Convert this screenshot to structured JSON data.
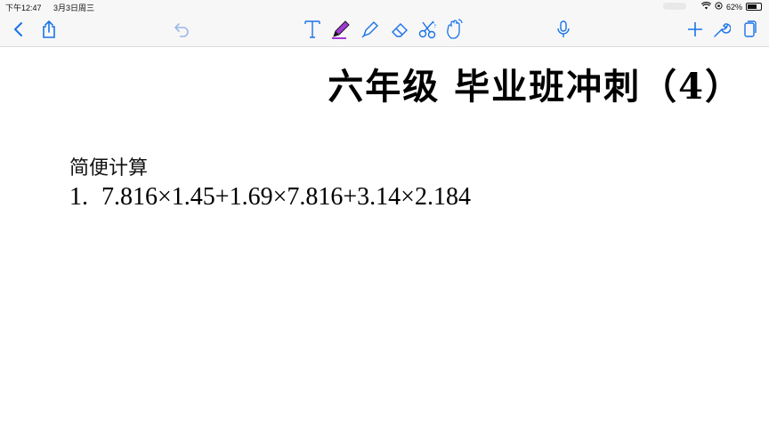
{
  "status_bar": {
    "time": "下午12:47",
    "date": "3月3日周三",
    "battery": "62%"
  },
  "toolbar": {
    "icons": [
      "back-icon",
      "share-icon",
      "undo-icon",
      "text-tool-icon",
      "pen-tool-icon",
      "highlighter-icon",
      "eraser-icon",
      "lasso-scissors-icon",
      "gesture-hand-icon",
      "microphone-icon",
      "add-icon",
      "settings-wrench-icon",
      "pages-icon"
    ],
    "accent_color": "#1a73e8",
    "pen_color": "#a338d6"
  },
  "document": {
    "title": "六年级   毕业班冲刺（4）",
    "section_label": "简便计算",
    "problems": [
      {
        "number": "1.",
        "expression": "7.816×1.45+1.69×7.816+3.14×2.184"
      }
    ]
  }
}
